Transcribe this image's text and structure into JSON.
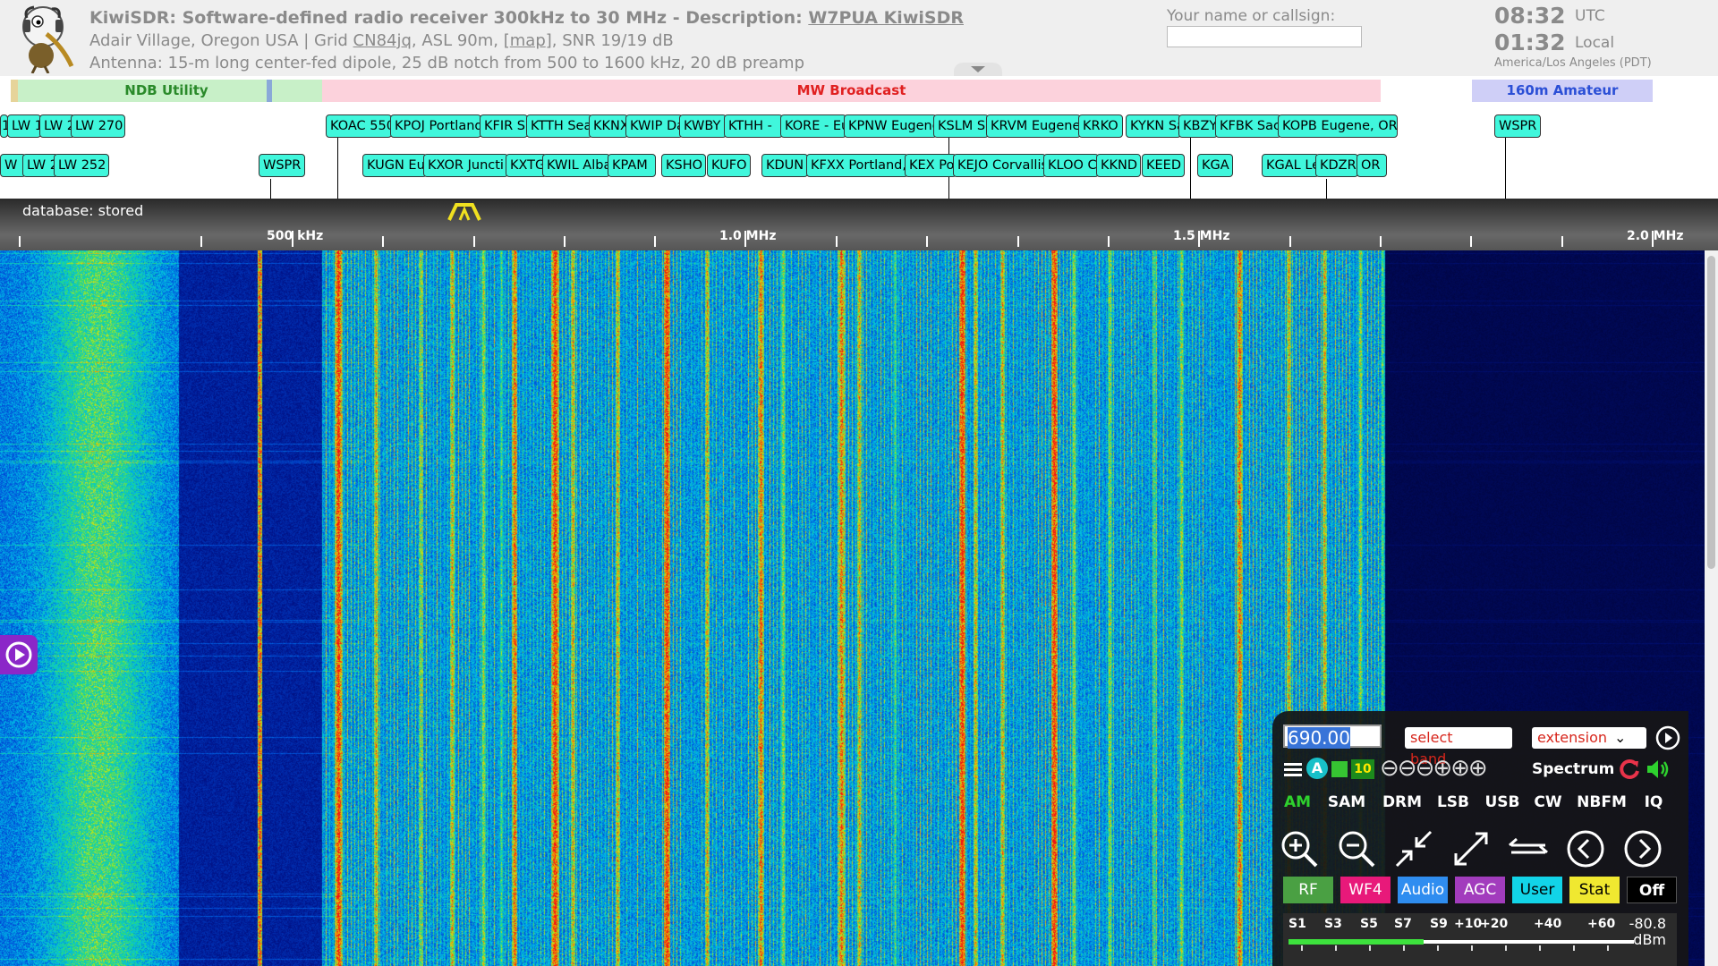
{
  "header": {
    "title_prefix": "KiwiSDR: Software-defined radio receiver 300kHz to 30 MHz - Description: ",
    "title_link": "W7PUA KiwiSDR",
    "loc_prefix": "Adair Village, Oregon USA | Grid ",
    "grid": "CN84jq",
    "loc_mid": ", ASL 90m, [",
    "map": "map",
    "loc_suffix": "], SNR 19/19 dB",
    "antenna": "Antenna: 15-m long center-fed dipole, 25 dB notch from 500 to 1600 kHz, 20 dB preamp",
    "callsign_label": "Your name or callsign:",
    "callsign_value": "",
    "utc_time": "08:32",
    "utc_label": "UTC",
    "local_time": "01:32",
    "local_label": "Local",
    "timezone": "America/Los Angeles (PDT)"
  },
  "bands": [
    {
      "name": "NDB Utility",
      "color": "#c8f0c8",
      "text_color": "#2a8a2a"
    },
    {
      "name": "MW Broadcast",
      "color": "#fcd2dc",
      "text_color": "#e02020"
    },
    {
      "name": "160m Amateur",
      "color": "#cfcff7",
      "text_color": "#2b4fd6"
    }
  ],
  "stations_row1": [
    "1",
    "LW 1",
    "LW 2",
    "LW 270",
    "KOAC 550",
    "KPOJ Portland",
    "KFIR S",
    "KTTH Sea",
    "KKNX",
    "KWIP Da",
    "KWBY",
    "KTHH -",
    "KORE - Eu",
    "KPNW Eugene",
    "KSLM Sa",
    "KRVM Eugene",
    "KRKO",
    "KYKN Sa",
    "KBZY",
    "KFBK Sac",
    "KOPB Eugene, OR",
    "WSPR"
  ],
  "stations_row2": [
    "W 1",
    "LW 2",
    "LW 252",
    "WSPR",
    "KUGN Eu",
    "KXOR Juncti",
    "KXTG",
    "KWIL Alba",
    "KPAM",
    "KSHO",
    "KUFO",
    "KDUN",
    "KFXX Portland,",
    "KEX Po",
    "KEJO Corvallis",
    "KLOO Co",
    "KKND",
    "KEED",
    "KGA",
    "KGAL Le",
    "KDZR",
    "OR"
  ],
  "scale": {
    "status": "database: stored",
    "labels": [
      "500 kHz",
      "1.0 MHz",
      "1.5 MHz",
      "2.0 MHz"
    ]
  },
  "controls": {
    "frequency": "690.00",
    "band_select": "select band",
    "extension_select": "extension",
    "agc_badge": "A",
    "step": "10",
    "spectrum": "Spectrum",
    "modes": [
      "AM",
      "SAM",
      "DRM",
      "LSB",
      "USB",
      "CW",
      "NBFM",
      "IQ"
    ],
    "active_mode": "AM",
    "categories": [
      "RF",
      "WF4",
      "Audio",
      "AGC",
      "User",
      "Stat",
      "Off"
    ],
    "cat_colors": [
      "#4aa043",
      "#e8197a",
      "#2f8df0",
      "#a23cbd",
      "#12d4e8",
      "#f0e830",
      "#000000"
    ],
    "smeter_labels": [
      "S1",
      "S3",
      "S5",
      "S7",
      "S9",
      "+10",
      "+20",
      "+40",
      "+60"
    ],
    "signal_dbm": "-80.8",
    "dbm_unit": "dBm",
    "signal_level": 0.39
  },
  "icons": [
    "kiwi-logo-icon",
    "play-icon",
    "hamburger-menu-icon",
    "zoom-in-icon",
    "zoom-out-icon",
    "zoom-fit-icon",
    "zoom-max-icon",
    "pan-icon",
    "prev-icon",
    "next-icon",
    "mute-speaker-icon",
    "reset-icon"
  ]
}
